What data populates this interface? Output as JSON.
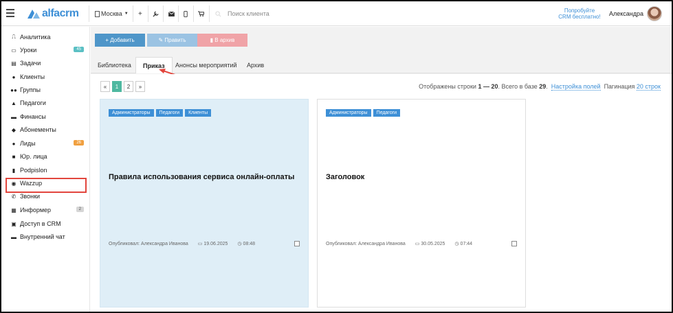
{
  "topbar": {
    "logo_text": "alfacrm",
    "city": "Москва",
    "search_placeholder": "Поиск клиента",
    "promo_line1": "Попробуйте",
    "promo_line2": "CRM бесплатно!",
    "user_name": "Александра",
    "icons": [
      "menu-icon",
      "plus-icon",
      "wrench-icon",
      "mail-icon",
      "phone-icon",
      "cart-icon"
    ]
  },
  "sidebar": {
    "items": [
      {
        "label": "Аналитика",
        "icon": "⎍"
      },
      {
        "label": "Уроки",
        "icon": "▭",
        "badge": "45"
      },
      {
        "label": "Задачи",
        "icon": "▤"
      },
      {
        "label": "Клиенты",
        "icon": "●"
      },
      {
        "label": "Группы",
        "icon": "●●"
      },
      {
        "label": "Педагоги",
        "icon": "▲"
      },
      {
        "label": "Финансы",
        "icon": "▬"
      },
      {
        "label": "Абонементы",
        "icon": "◆"
      },
      {
        "label": "Лиды",
        "icon": "●",
        "badge": "26"
      },
      {
        "label": "Юр. лица",
        "icon": "■"
      },
      {
        "label": "Podpislon",
        "icon": "▮"
      },
      {
        "label": "Wazzup",
        "icon": "◉"
      },
      {
        "label": "Звонки",
        "icon": "✆"
      },
      {
        "label": "Информер",
        "icon": "▦",
        "badge": "2"
      },
      {
        "label": "Доступ в CRM",
        "icon": "▣"
      },
      {
        "label": "Внутренний чат",
        "icon": "▬"
      }
    ]
  },
  "toolbar": {
    "add_label": "+ Добавить",
    "edit_label": "✎ Править",
    "archive_label": "▮ В архив"
  },
  "tabs": [
    {
      "label": "Библиотека"
    },
    {
      "label": "Приказ",
      "active": true
    },
    {
      "label": "Анонсы мероприятий"
    },
    {
      "label": "Архив"
    }
  ],
  "pager": {
    "prev": "«",
    "pages": [
      "1",
      "2"
    ],
    "next": "»",
    "current": "1"
  },
  "rows_info": {
    "prefix": "Отображены строки ",
    "range": "1 — 20",
    "middle": ". Всего в базе ",
    "total": "29",
    "end": ".",
    "settings_link": "Настройка полей",
    "pagination_label": "Пагинация ",
    "pagination_link": "20 строк"
  },
  "cards": [
    {
      "tags": [
        "Администраторы",
        "Педагоги",
        "Клиенты"
      ],
      "title": "Правила использования сервиса онлайн-оплаты",
      "author": "Опубликовал: Александра Иванова",
      "date": "19.06.2025",
      "time": "08:48"
    },
    {
      "tags": [
        "Администраторы",
        "Педагоги"
      ],
      "title": "Заголовок",
      "author": "Опубликовал: Александра Иванова",
      "date": "30.05.2025",
      "time": "07:44"
    }
  ],
  "colors": {
    "accent": "#3d8fd6",
    "highlight": "#e2453c",
    "active_page": "#4eb8a0"
  }
}
